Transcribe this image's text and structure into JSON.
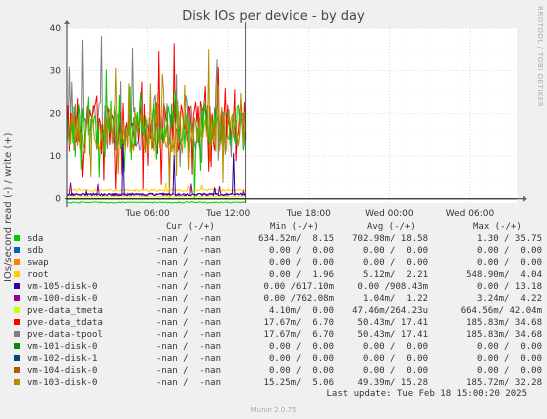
{
  "title": "Disk IOs per device - by day",
  "ylabel": "IOs/second read (-) / write (+)",
  "side_label": "RRDTOOL / TOBI OETIKER",
  "chart_data": {
    "type": "line",
    "title": "Disk IOs per device - by day",
    "ylabel": "IOs/second read (-) / write (+)",
    "ylim": [
      -1,
      40
    ],
    "yticks": [
      0,
      10,
      20,
      30,
      40
    ],
    "xlim_hours": [
      0,
      30
    ],
    "xticks": [
      {
        "label": "Tue 06:00",
        "hour": 6
      },
      {
        "label": "Tue 12:00",
        "hour": 12
      },
      {
        "label": "Tue 18:00",
        "hour": 18
      },
      {
        "label": "Wed 00:00",
        "hour": 24
      },
      {
        "label": "Wed 06:00",
        "hour": 30
      }
    ],
    "data_end_hour": 13.3,
    "grid": true,
    "series": [
      {
        "name": "sda",
        "color": "#00cc00",
        "approx_level": 17,
        "approx_range": [
          5,
          32
        ]
      },
      {
        "name": "sdb",
        "color": "#0066b3",
        "approx_level": 0
      },
      {
        "name": "swap",
        "color": "#ff8000",
        "approx_level": 0
      },
      {
        "name": "root",
        "color": "#ffcc00",
        "approx_level": 2,
        "approx_range": [
          1,
          4
        ]
      },
      {
        "name": "vm-105-disk-0",
        "color": "#330099",
        "approx_level": 1,
        "approx_range": [
          0,
          13
        ]
      },
      {
        "name": "vm-100-disk-0",
        "color": "#990099",
        "approx_level": 1,
        "approx_range": [
          0,
          4
        ]
      },
      {
        "name": "pve-data_tmeta",
        "color": "#ccff00",
        "approx_level": 0.5
      },
      {
        "name": "pve-data_tdata",
        "color": "#ff0000",
        "approx_level": 17,
        "approx_range": [
          5,
          34
        ]
      },
      {
        "name": "pve-data-tpool",
        "color": "#808080",
        "approx_level": 17,
        "approx_range": [
          5,
          34
        ]
      },
      {
        "name": "vm-101-disk-0",
        "color": "#008f00",
        "approx_level": 0
      },
      {
        "name": "vm-102-disk-1",
        "color": "#00487d",
        "approx_level": 0
      },
      {
        "name": "vm-104-disk-0",
        "color": "#b35a00",
        "approx_level": 0
      },
      {
        "name": "vm-103-disk-0",
        "color": "#b38f00",
        "approx_level": 16,
        "approx_range": [
          5,
          32
        ]
      }
    ]
  },
  "legend": {
    "headers": {
      "cur": "Cur (-/+)",
      "min": "Min (-/+)",
      "avg": "Avg (-/+)",
      "max": "Max (-/+)"
    },
    "rows": [
      {
        "name": "sda",
        "color": "#00cc00",
        "cur": "-nan /  -nan",
        "min": "634.52m/  8.15",
        "avg": "702.98m/ 18.58",
        "max": "1.30 / 35.75"
      },
      {
        "name": "sdb",
        "color": "#0066b3",
        "cur": "-nan /  -nan",
        "min": "0.00 /  0.00",
        "avg": "0.00 /  0.00",
        "max": "0.00 /  0.00"
      },
      {
        "name": "swap",
        "color": "#ff8000",
        "cur": "-nan /  -nan",
        "min": "0.00 /  0.00",
        "avg": "0.00 /  0.00",
        "max": "0.00 /  0.00"
      },
      {
        "name": "root",
        "color": "#ffcc00",
        "cur": "-nan /  -nan",
        "min": "0.00 /  1.96",
        "avg": "5.12m/  2.21",
        "max": "548.90m/  4.04"
      },
      {
        "name": "vm-105-disk-0",
        "color": "#330099",
        "cur": "-nan /  -nan",
        "min": "0.00 /617.10m",
        "avg": "0.00 /908.43m",
        "max": "0.00 / 13.18"
      },
      {
        "name": "vm-100-disk-0",
        "color": "#990099",
        "cur": "-nan /  -nan",
        "min": "0.00 /762.08m",
        "avg": "1.04m/  1.22",
        "max": "3.24m/  4.22"
      },
      {
        "name": "pve-data_tmeta",
        "color": "#ccff00",
        "cur": "-nan /  -nan",
        "min": "4.10m/  0.00",
        "avg": "47.46m/264.23u",
        "max": "664.56m/ 42.04m"
      },
      {
        "name": "pve-data_tdata",
        "color": "#ff0000",
        "cur": "-nan /  -nan",
        "min": "17.67m/  6.70",
        "avg": "50.43m/ 17.41",
        "max": "185.83m/ 34.68"
      },
      {
        "name": "pve-data-tpool",
        "color": "#808080",
        "cur": "-nan /  -nan",
        "min": "17.67m/  6.70",
        "avg": "50.43m/ 17.41",
        "max": "185.83m/ 34.68"
      },
      {
        "name": "vm-101-disk-0",
        "color": "#008f00",
        "cur": "-nan /  -nan",
        "min": "0.00 /  0.00",
        "avg": "0.00 /  0.00",
        "max": "0.00 /  0.00"
      },
      {
        "name": "vm-102-disk-1",
        "color": "#00487d",
        "cur": "-nan /  -nan",
        "min": "0.00 /  0.00",
        "avg": "0.00 /  0.00",
        "max": "0.00 /  0.00"
      },
      {
        "name": "vm-104-disk-0",
        "color": "#b35a00",
        "cur": "-nan /  -nan",
        "min": "0.00 /  0.00",
        "avg": "0.00 /  0.00",
        "max": "0.00 /  0.00"
      },
      {
        "name": "vm-103-disk-0",
        "color": "#b38f00",
        "cur": "-nan /  -nan",
        "min": "15.25m/  5.06",
        "avg": "49.39m/ 15.28",
        "max": "185.72m/ 32.28"
      }
    ]
  },
  "last_update": "Last update: Tue Feb 18 15:00:20 2025",
  "munin_version": "Munin 2.0.75"
}
